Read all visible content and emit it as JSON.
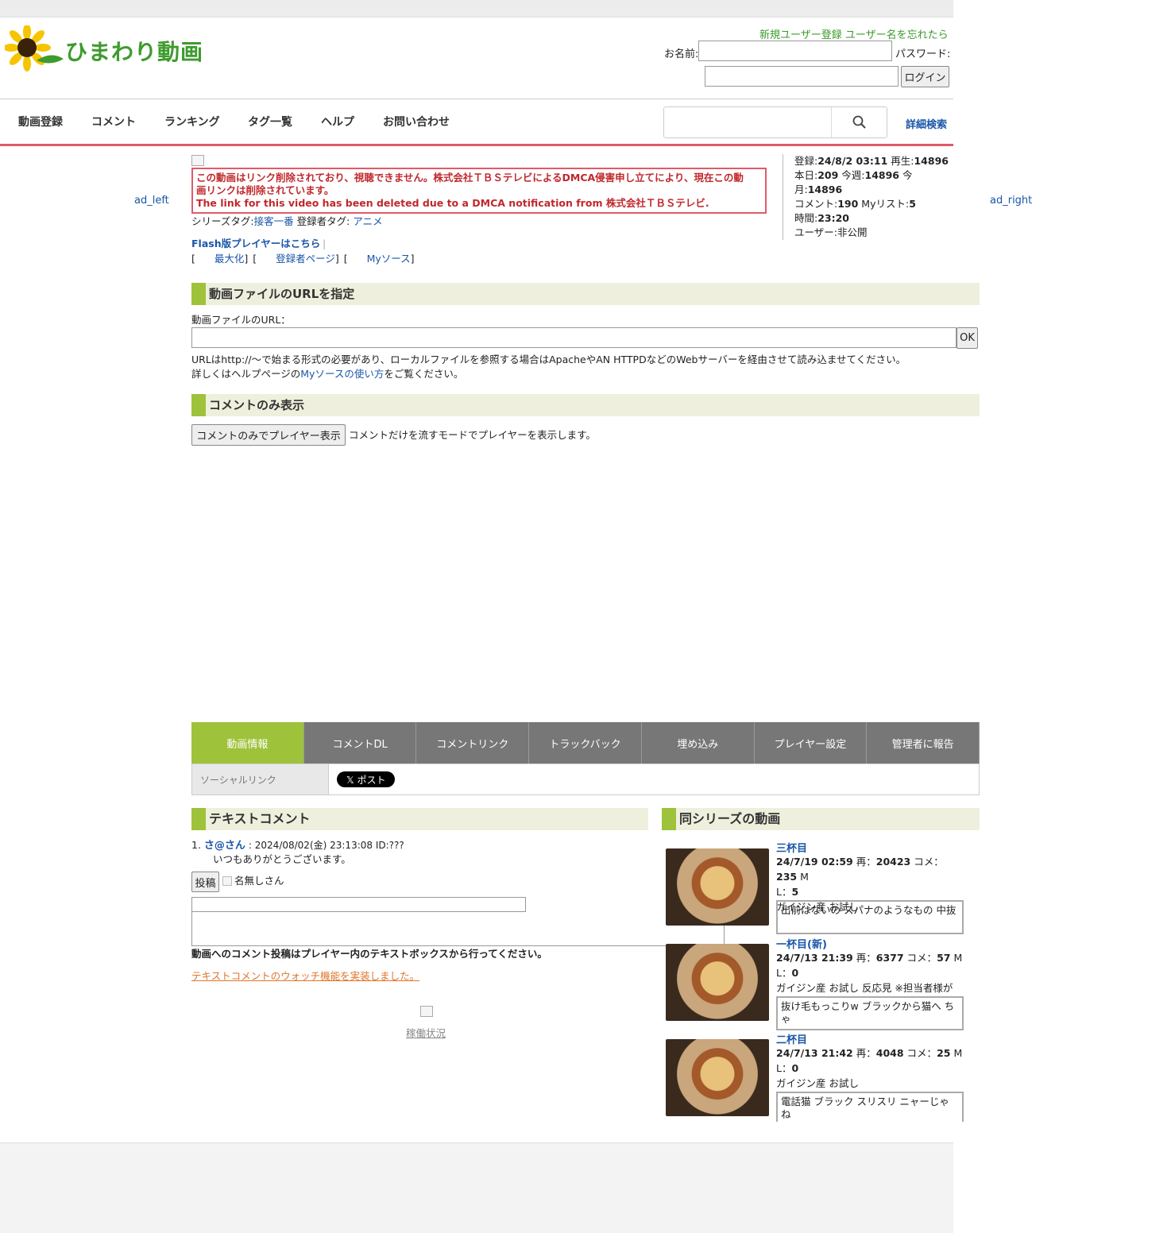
{
  "header": {
    "logo_text": "ひまわり動画",
    "register_link": "新規ユーザー登録",
    "forgot_link": "ユーザー名を忘れたら",
    "name_label": "お名前:",
    "password_label": "パスワード:",
    "login_button": "ログイン"
  },
  "nav": {
    "items": [
      "動画登録",
      "コメント",
      "ランキング",
      "タグ一覧",
      "ヘルプ",
      "お問い合わせ"
    ],
    "advanced_search": "詳細検索"
  },
  "ads": {
    "left": "ad_left",
    "right": "ad_right"
  },
  "video": {
    "dmca_line1": "この動画はリンク削除されており、視聴できません。株式会社ＴＢＳテレビによるDMCA侵害申し立てにより、現在この動",
    "dmca_line2": "画リンクは削除されています。",
    "dmca_line3": "The link for this video has been deleted due to a DMCA notification from 株式会社ＴＢＳテレビ.",
    "series_tag_label": "シリーズタグ:",
    "series_tag": "接客一番",
    "owner_tag_label": "登録者タグ:",
    "owner_tag": "アニメ",
    "flash_link": "Flash版プレイヤーはこちら",
    "maximize": "最大化",
    "owner_page": "登録者ページ",
    "my_source": "Myソース"
  },
  "info": {
    "registered_label": "登録:",
    "registered": "24/8/2 03:11",
    "plays_label": "再生:",
    "plays": "14896",
    "today_label": "本日:",
    "today": "209",
    "week_label": "今週:",
    "week": "14896",
    "month_label": "今月:",
    "month": "14896",
    "comments_label": "コメント:",
    "comments": "190",
    "mylist_label": "Myリスト:",
    "mylist": "5",
    "duration_label": "時間:",
    "duration": "23:20",
    "user_label": "ユーザー:",
    "user": "非公開"
  },
  "url_section": {
    "title": "動画ファイルのURLを指定",
    "field_label": "動画ファイルのURL：",
    "ok_button": "OK",
    "note1": "URLはhttp://～で始まる形式の必要があり、ローカルファイルを参照する場合はApacheやAN HTTPDなどのWebサーバーを経由させて読み込ませてください。",
    "note2_pre": "詳しくはヘルプページの",
    "note2_link": "Myソースの使い方",
    "note2_post": "をご覧ください。"
  },
  "comment_only": {
    "title": "コメントのみ表示",
    "button": "コメントのみでプレイヤー表示",
    "desc": "コメントだけを流すモードでプレイヤーを表示します。"
  },
  "tabs": [
    "動画情報",
    "コメントDL",
    "コメントリンク",
    "トラックバック",
    "埋め込み",
    "プレイヤー設定",
    "管理者に報告"
  ],
  "social": {
    "label": "ソーシャルリンク",
    "post_button": "𝕏 ポスト"
  },
  "text_comments": {
    "title": "テキストコメント",
    "items": [
      {
        "num": "1.",
        "name": "さ@さん",
        "meta": ": 2024/08/02(金) 23:13:08 ID:???",
        "body": "いつもありがとうございます。"
      }
    ],
    "post_button": "投稿",
    "anonymous_label": "名無しさん",
    "notice": "動画へのコメント投稿はプレイヤー内のテキストボックスから行ってください。",
    "watch_link": "テキストコメントのウォッチ機能を実装しました。",
    "status_link": "稼働状況"
  },
  "series": {
    "title": "同シリーズの動画",
    "items": [
      {
        "title": "三杯目",
        "date": "24/7/19 02:59",
        "plays": "20423",
        "comments": "235",
        "ml": "5",
        "tags": "ガイジン産 お試し",
        "comment_preview": "出前はないの スパナのようなもの 中抜"
      },
      {
        "title": "一杯目(新)",
        "date": "24/7/13 21:39",
        "plays": "6377",
        "comments": "57",
        "ml": "0",
        "tags": "ガイジン産 お試し 反応見 ※担当者様が",
        "comment_preview": "抜け毛もっこりw ブラックから猫へ ちゃ"
      },
      {
        "title": "二杯目",
        "date": "24/7/13 21:42",
        "plays": "4048",
        "comments": "25",
        "ml": "0",
        "tags": "ガイジン産 お試し",
        "comment_preview": "電話猫 ブラック スリスリ ニャーじゃね"
      }
    ],
    "plays_label": "再：",
    "comments_label": "コメ：",
    "ml_label": "M",
    "ml_label2": "L：",
    "sep": " "
  },
  "colors": {
    "accent": "#9ec23a",
    "nav_line": "#e05a6a",
    "link": "#1a56a8",
    "dmca": "#c0282c"
  }
}
